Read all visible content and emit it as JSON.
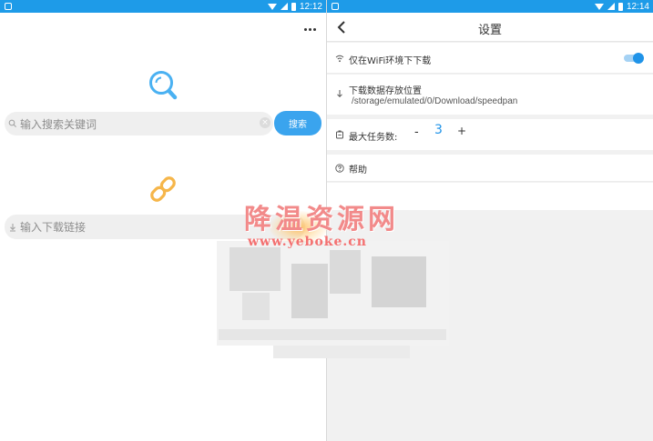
{
  "status_bar_left": {
    "time": "12:12"
  },
  "status_bar_right": {
    "time": "12:14"
  },
  "left_screen": {
    "menu_icon": "more-vertical-dots",
    "search_logo_icon": "magnifier",
    "search": {
      "placeholder": "输入搜索关键词",
      "clear_icon": "close",
      "button_label": "搜索"
    },
    "link_logo_icon": "chain-link",
    "link_input": {
      "placeholder": "输入下载链接"
    }
  },
  "right_screen": {
    "title": "设置",
    "back_icon": "chevron-left",
    "settings": {
      "wifi_only": {
        "label": "仅在WiFi环境下下载",
        "icon": "wifi",
        "enabled": true
      },
      "download_path": {
        "label": "下载数据存放位置",
        "value": "/storage/emulated/0/Download/speedpan",
        "icon": "download-arrow"
      },
      "max_tasks": {
        "label": "最大任务数:",
        "minus": "-",
        "value": "3",
        "plus": "+",
        "icon": "task-box"
      },
      "help": {
        "label": "帮助",
        "icon": "question-circle"
      }
    }
  },
  "watermark": {
    "text": "降温资源网",
    "url": "www.yeboke.cn"
  },
  "colors": {
    "accent": "#1f93e8",
    "status_bar": "#1e9be8",
    "search_button": "#3aa4ee",
    "logo_blue": "#4ab1f2",
    "logo_orange": "#f6b64a",
    "watermark_red": "#f28a8a"
  }
}
